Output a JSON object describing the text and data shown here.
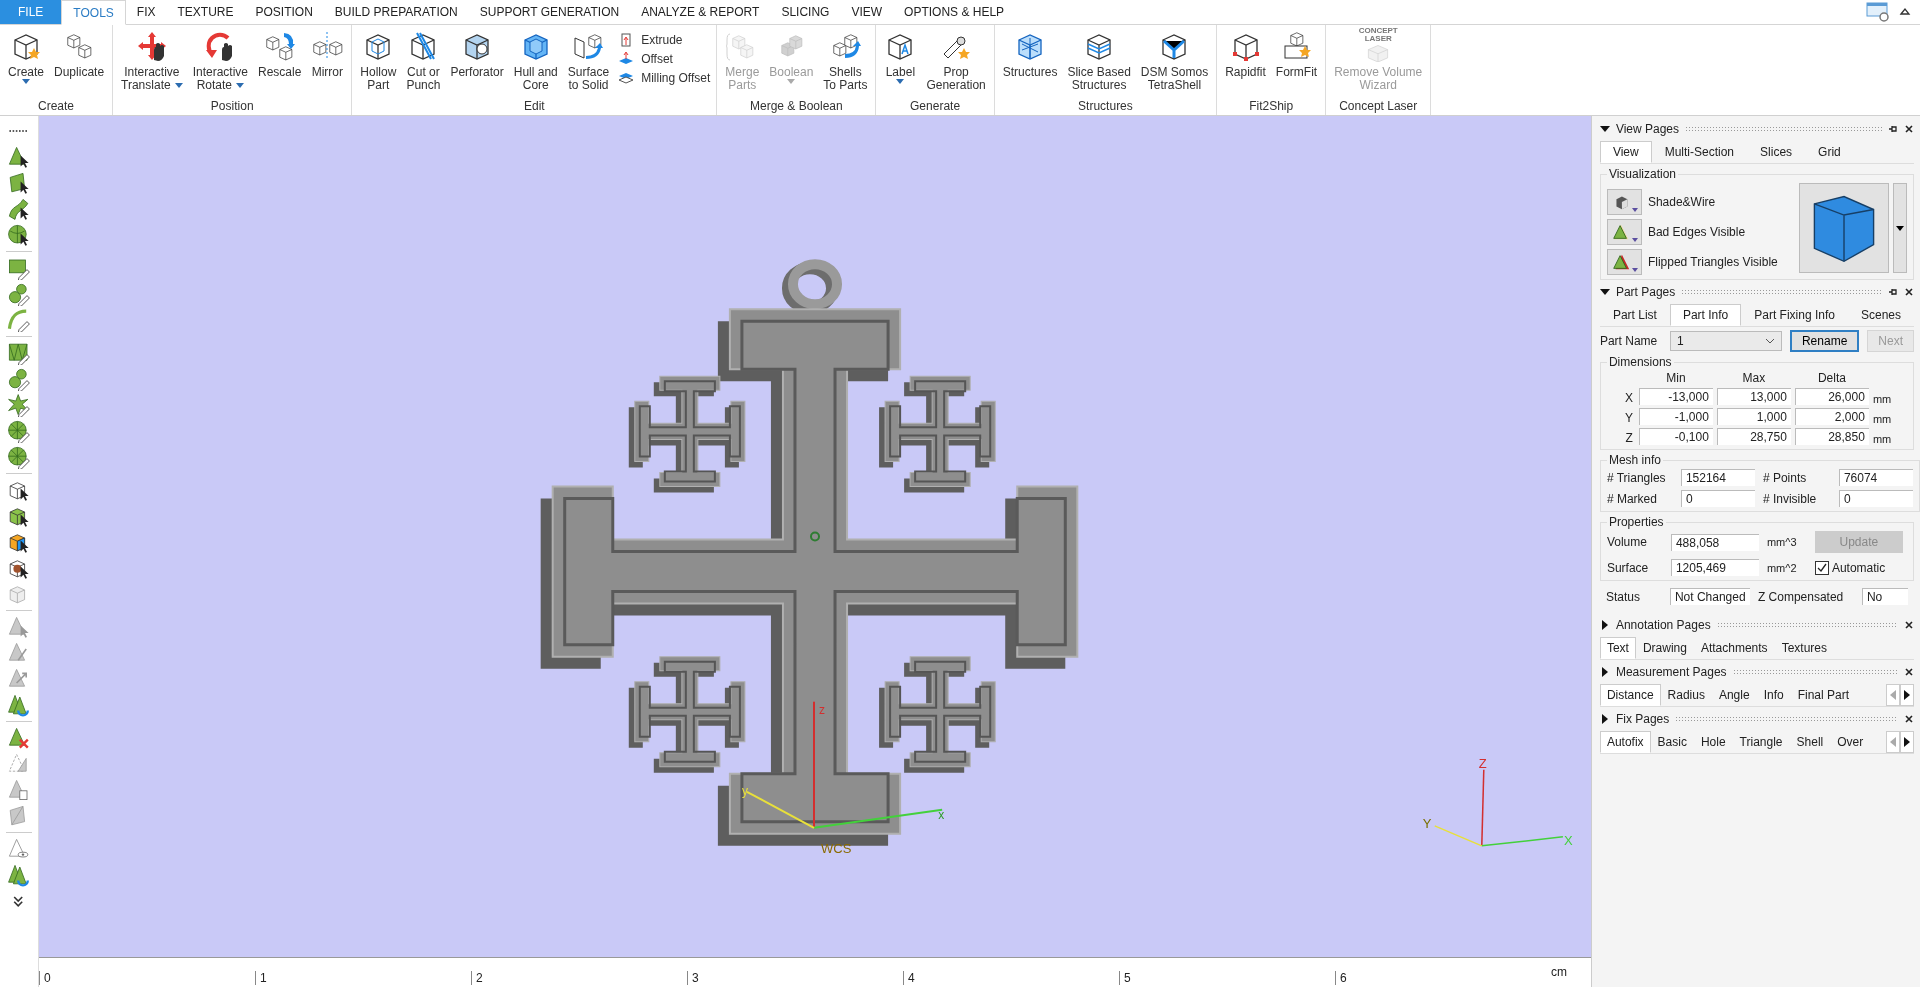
{
  "menu_tabs": [
    {
      "label": "FILE",
      "kind": "file",
      "selected": false
    },
    {
      "label": "TOOLS",
      "kind": "tab",
      "selected": true
    },
    {
      "label": "FIX",
      "kind": "tab",
      "selected": false
    },
    {
      "label": "TEXTURE",
      "kind": "tab",
      "selected": false
    },
    {
      "label": "POSITION",
      "kind": "tab",
      "selected": false
    },
    {
      "label": "BUILD PREPARATION",
      "kind": "tab",
      "selected": false
    },
    {
      "label": "SUPPORT GENERATION",
      "kind": "tab",
      "selected": false
    },
    {
      "label": "ANALYZE & REPORT",
      "kind": "tab",
      "selected": false
    },
    {
      "label": "SLICING",
      "kind": "tab",
      "selected": false
    },
    {
      "label": "VIEW",
      "kind": "tab",
      "selected": false
    },
    {
      "label": "OPTIONS & HELP",
      "kind": "tab",
      "selected": false
    }
  ],
  "ribbon": [
    {
      "title": "Create",
      "items": [
        {
          "kind": "large",
          "lines": [
            "Create"
          ],
          "dropdown": true,
          "disabled": false
        },
        {
          "kind": "large",
          "lines": [
            "Duplicate"
          ],
          "dropdown": false,
          "disabled": false
        }
      ]
    },
    {
      "title": "Position",
      "items": [
        {
          "kind": "large",
          "lines": [
            "Interactive",
            "Translate"
          ],
          "dropdown": true,
          "disabled": false
        },
        {
          "kind": "large",
          "lines": [
            "Interactive",
            "Rotate"
          ],
          "dropdown": true,
          "disabled": false
        },
        {
          "kind": "large",
          "lines": [
            "Rescale"
          ],
          "dropdown": false,
          "disabled": false
        },
        {
          "kind": "large",
          "lines": [
            "Mirror"
          ],
          "dropdown": false,
          "disabled": false
        }
      ]
    },
    {
      "title": "Edit",
      "items": [
        {
          "kind": "large",
          "lines": [
            "Hollow",
            "Part"
          ],
          "dropdown": false,
          "disabled": false
        },
        {
          "kind": "large",
          "lines": [
            "Cut or",
            "Punch"
          ],
          "dropdown": false,
          "disabled": false
        },
        {
          "kind": "large",
          "lines": [
            "Perforator"
          ],
          "dropdown": false,
          "disabled": false
        },
        {
          "kind": "large",
          "lines": [
            "Hull and",
            "Core"
          ],
          "dropdown": false,
          "disabled": false
        },
        {
          "kind": "large",
          "lines": [
            "Surface",
            "to Solid"
          ],
          "dropdown": false,
          "disabled": false
        },
        {
          "kind": "stack",
          "entries": [
            {
              "label": "Extrude"
            },
            {
              "label": "Offset"
            },
            {
              "label": "Milling Offset"
            }
          ]
        }
      ]
    },
    {
      "title": "Merge & Boolean",
      "items": [
        {
          "kind": "large",
          "lines": [
            "Merge",
            "Parts"
          ],
          "dropdown": false,
          "disabled": true
        },
        {
          "kind": "large",
          "lines": [
            "Boolean"
          ],
          "dropdown": true,
          "disabled": true
        },
        {
          "kind": "large",
          "lines": [
            "Shells",
            "To Parts"
          ],
          "dropdown": false,
          "disabled": false
        }
      ]
    },
    {
      "title": "Generate",
      "items": [
        {
          "kind": "large",
          "lines": [
            "Label"
          ],
          "dropdown": true,
          "disabled": false
        },
        {
          "kind": "large",
          "lines": [
            "Prop",
            "Generation"
          ],
          "dropdown": false,
          "disabled": false
        }
      ]
    },
    {
      "title": "Structures",
      "items": [
        {
          "kind": "large",
          "lines": [
            "Structures"
          ],
          "dropdown": false,
          "disabled": false
        },
        {
          "kind": "large",
          "lines": [
            "Slice Based",
            "Structures"
          ],
          "dropdown": false,
          "disabled": false
        },
        {
          "kind": "large",
          "lines": [
            "DSM Somos",
            "TetraShell"
          ],
          "dropdown": false,
          "disabled": false
        }
      ]
    },
    {
      "title": "Fit2Ship",
      "items": [
        {
          "kind": "large",
          "lines": [
            "Rapidfit"
          ],
          "dropdown": false,
          "disabled": false
        },
        {
          "kind": "large",
          "lines": [
            "FormFit"
          ],
          "dropdown": false,
          "disabled": false
        }
      ]
    },
    {
      "title": "Concept Laser",
      "items": [
        {
          "kind": "large",
          "lines": [
            "Remove Volume",
            "Wizard"
          ],
          "dropdown": false,
          "disabled": true,
          "logo_lines": [
            "CONCEPT",
            "LASER"
          ]
        }
      ]
    }
  ],
  "viewport": {
    "axes": {
      "z": "z",
      "y": "y",
      "x": "x"
    },
    "wcs_label": "WCS",
    "mini_axes": {
      "z": "Z",
      "y": "Y",
      "x": "X"
    }
  },
  "ruler": {
    "ticks": [
      "0",
      "1",
      "2",
      "3",
      "4",
      "5",
      "6"
    ],
    "unit": "cm"
  },
  "view_pages": {
    "title": "View Pages",
    "expanded": true,
    "tabs": [
      {
        "label": "View",
        "selected": true
      },
      {
        "label": "Multi-Section",
        "selected": false
      },
      {
        "label": "Slices",
        "selected": false
      },
      {
        "label": "Grid",
        "selected": false
      }
    ],
    "group": "Visualization",
    "options": [
      "Shade&Wire",
      "Bad Edges Visible",
      "Flipped Triangles Visible"
    ]
  },
  "part_pages": {
    "title": "Part Pages",
    "expanded": true,
    "tabs": [
      {
        "label": "Part List",
        "selected": false
      },
      {
        "label": "Part Info",
        "selected": true
      },
      {
        "label": "Part Fixing Info",
        "selected": false
      },
      {
        "label": "Scenes",
        "selected": false
      }
    ],
    "part_name": {
      "label": "Part Name",
      "value": "1"
    },
    "buttons": [
      {
        "label": "Rename",
        "disabled": false
      },
      {
        "label": "Next",
        "disabled": true
      }
    ],
    "dimensions": {
      "title": "Dimensions",
      "columns": [
        "Min",
        "Max",
        "Delta"
      ],
      "rows": [
        {
          "axis": "X",
          "values": [
            "-13,000",
            "13,000",
            "26,000"
          ],
          "unit": "mm"
        },
        {
          "axis": "Y",
          "values": [
            "-1,000",
            "1,000",
            "2,000"
          ],
          "unit": "mm"
        },
        {
          "axis": "Z",
          "values": [
            "-0,100",
            "28,750",
            "28,850"
          ],
          "unit": "mm"
        }
      ]
    },
    "mesh_info": {
      "title": "Mesh info",
      "fields": [
        {
          "label": "# Triangles",
          "value": "152164"
        },
        {
          "label": "# Points",
          "value": "76074"
        },
        {
          "label": "# Marked",
          "value": "0"
        },
        {
          "label": "# Invisible",
          "value": "0"
        }
      ]
    },
    "properties": {
      "title": "Properties",
      "fields": [
        {
          "label": "Volume",
          "value": "488,058",
          "unit": "mm^3"
        },
        {
          "label": "Surface",
          "value": "1205,469",
          "unit": "mm^2"
        }
      ],
      "update": {
        "label": "Update",
        "disabled": true
      },
      "automatic": {
        "label": "Automatic",
        "checked": true
      }
    },
    "status": [
      {
        "label": "Status",
        "value": "Not Changed"
      },
      {
        "label": "Z Compensated",
        "value": "No"
      }
    ]
  },
  "collapsed_pages": [
    {
      "title": "Annotation Pages",
      "expanded": false,
      "scroll_arrows": false,
      "tabs": [
        {
          "label": "Text",
          "selected": true
        },
        {
          "label": "Drawing",
          "selected": false
        },
        {
          "label": "Attachments",
          "selected": false
        },
        {
          "label": "Textures",
          "selected": false
        }
      ]
    },
    {
      "title": "Measurement Pages",
      "expanded": false,
      "scroll_arrows": true,
      "tabs": [
        {
          "label": "Distance",
          "selected": true
        },
        {
          "label": "Radius",
          "selected": false
        },
        {
          "label": "Angle",
          "selected": false
        },
        {
          "label": "Info",
          "selected": false
        },
        {
          "label": "Final Part",
          "selected": false
        }
      ]
    },
    {
      "title": "Fix Pages",
      "expanded": false,
      "scroll_arrows": true,
      "tabs": [
        {
          "label": "Autofix",
          "selected": true
        },
        {
          "label": "Basic",
          "selected": false
        },
        {
          "label": "Hole",
          "selected": false
        },
        {
          "label": "Triangle",
          "selected": false
        },
        {
          "label": "Shell",
          "selected": false
        },
        {
          "label": "Over",
          "selected": false
        }
      ]
    }
  ]
}
